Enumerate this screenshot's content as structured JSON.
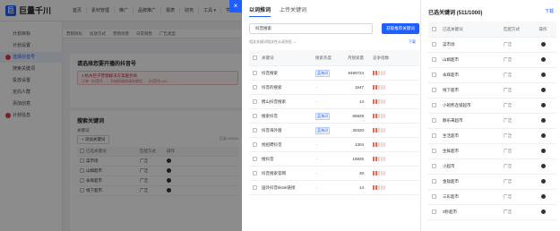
{
  "logo": {
    "text": "巨量千川"
  },
  "top_nav": [
    "首页",
    "素材管理",
    "推广",
    "品牌推广",
    "报表",
    "财务",
    "工具 ▾",
    "学堂"
  ],
  "sidebar": {
    "items": [
      {
        "label": "计划目标",
        "marker": false
      },
      {
        "label": "计划设置",
        "marker": false
      },
      {
        "label": "选择抖音号",
        "marker": true,
        "active": true
      },
      {
        "label": "搜索关键词",
        "marker": false
      },
      {
        "label": "投放设置",
        "marker": false
      },
      {
        "label": "定向人群",
        "marker": false
      },
      {
        "label": "添加创意",
        "marker": false
      },
      {
        "label": "计划信息",
        "marker": true
      }
    ]
  },
  "main": {
    "tabs": [
      "营销目标",
      "投放方式",
      "营销场景",
      "日常销售",
      "广告类型"
    ],
    "account_title": "请选择您要开播的抖音号",
    "tip_line1": "J 杭州巨子营销解决方案服务商",
    "tip_line2": "订单（抖音号…）开始投放前请先绑定…（抖音号=xx）…",
    "search_title": "搜索关键词",
    "kw_label": "关键词",
    "add_btn": "+ 添加关键词",
    "added": "已选 0/1000",
    "mini_cols": [
      "已选关键词",
      "匹配方式",
      "操作"
    ],
    "mini_rows": [
      {
        "kw": "菜市场",
        "match": "广泛"
      },
      {
        "kw": "山姆超市",
        "match": "广泛"
      },
      {
        "kw": "永辉超市",
        "match": "广泛"
      },
      {
        "kw": "线下超市",
        "match": "广泛"
      }
    ]
  },
  "modal": {
    "close": "×",
    "tabs": [
      "以词推词",
      "上传关键词"
    ],
    "search_value": "抖音搜索",
    "get_btn": "获取推荐关键词",
    "hint": "相关关键词相关性从高到低 ⌄",
    "download": "下载",
    "columns": [
      "关键词",
      "搜索热度",
      "月搜索量",
      "竞争指数"
    ],
    "rows": [
      {
        "kw": "抖音搜索",
        "tag": "蓝海词",
        "volume": "6490724",
        "comp": 2
      },
      {
        "kw": "抖音的搜索",
        "tag": "",
        "volume": "1647",
        "comp": 2
      },
      {
        "kw": "携山抖音搜索",
        "tag": "",
        "volume": "14",
        "comp": 2
      },
      {
        "kw": "搜索抖音",
        "tag": "蓝海词",
        "volume": "66929",
        "comp": 2
      },
      {
        "kw": "抖音海外版",
        "tag": "蓝海词",
        "volume": "30320",
        "comp": 2
      },
      {
        "kw": "找招聘抖音",
        "tag": "",
        "volume": "1304",
        "comp": 2
      },
      {
        "kw": "搜抖音",
        "tag": "",
        "volume": "15825",
        "comp": 2
      },
      {
        "kw": "抖音搜索官网",
        "tag": "",
        "volume": "30",
        "comp": 2
      },
      {
        "kw": "国外抖音tiktok链接",
        "tag": "",
        "volume": "14",
        "comp": 2
      }
    ],
    "selected_title": "已选关键词 (511/1000)",
    "selected_download": "下载",
    "selected_columns": [
      "已选关键词",
      "匹配方式",
      "操作"
    ],
    "selected_rows": [
      {
        "kw": "菜市场",
        "match": "广泛"
      },
      {
        "kw": "山姆超市",
        "match": "广泛"
      },
      {
        "kw": "永辉超市",
        "match": "广泛"
      },
      {
        "kw": "线下超市",
        "match": "广泛"
      },
      {
        "kw": "小袍熊连锁超市",
        "match": "广泛"
      },
      {
        "kw": "静乐来超市",
        "match": "广泛"
      },
      {
        "kw": "生活超市",
        "match": "广泛"
      },
      {
        "kw": "生鲜超市",
        "match": "广泛"
      },
      {
        "kw": "小超市",
        "match": "广泛"
      },
      {
        "kw": "金辐超市",
        "match": "广泛"
      },
      {
        "kw": "三彩超市",
        "match": "广泛"
      },
      {
        "kw": "3秒超市",
        "match": "广泛"
      }
    ]
  },
  "colors": {
    "accent": "#1f5fff",
    "danger": "#e13a3a",
    "competition": "#ff5a3a"
  }
}
